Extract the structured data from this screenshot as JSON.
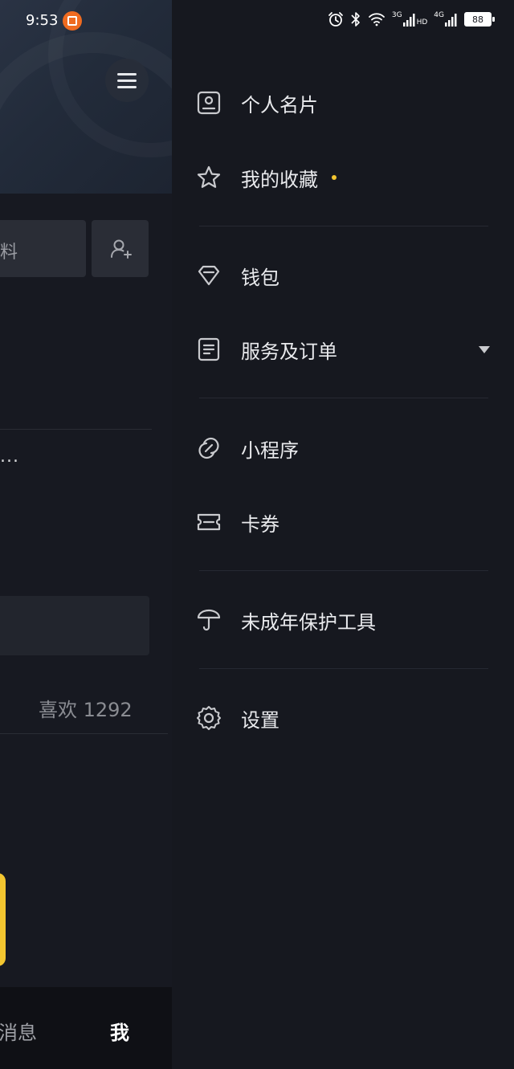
{
  "status_bar": {
    "time": "9:53",
    "network_3g": "3G",
    "network_hd": "HD",
    "network_4g": "4G",
    "battery": "88",
    "icons": [
      "alarm-icon",
      "bluetooth-icon",
      "wifi-icon",
      "signal-icon",
      "battery-icon"
    ]
  },
  "left_page": {
    "edit_button_partial": "料",
    "ellipsis_text": "...",
    "likes_text": "喜欢 1292",
    "bottom_nav": {
      "messages_partial": "消息",
      "me": "我"
    }
  },
  "drawer": {
    "items": [
      {
        "label": "个人名片",
        "icon": "profile-card-icon"
      },
      {
        "label": "我的收藏",
        "icon": "star-icon",
        "has_dot": true
      },
      {
        "label": "钱包",
        "icon": "diamond-icon"
      },
      {
        "label": "服务及订单",
        "icon": "document-icon",
        "has_caret": true
      },
      {
        "label": "小程序",
        "icon": "link-icon"
      },
      {
        "label": "卡券",
        "icon": "ticket-icon"
      },
      {
        "label": "未成年保护工具",
        "icon": "umbrella-icon"
      },
      {
        "label": "设置",
        "icon": "gear-icon"
      }
    ]
  },
  "colors": {
    "background": "#16181f",
    "accent_yellow": "#f3c630",
    "badge_orange": "#ef6b20"
  }
}
